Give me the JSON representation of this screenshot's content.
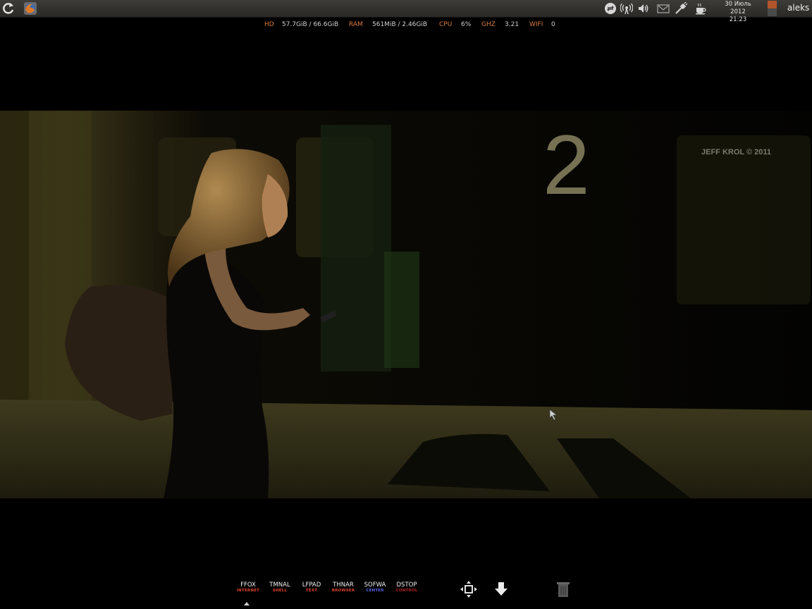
{
  "top_panel": {
    "clock": {
      "date": "30 Июль 2012",
      "time": "21:23"
    },
    "user": "aleks",
    "icons": [
      "refresh-icon",
      "firefox-icon",
      "sync-icon",
      "wifi-signal-icon",
      "volume-icon",
      "mail-icon",
      "network-cable-icon",
      "coffee-cup-icon"
    ]
  },
  "conky": {
    "hd_label": "HD",
    "hd_value": "57.7GiB / 66.6GiB",
    "ram_label": "RAM",
    "ram_value": "561MiB / 2.46GiB",
    "cpu_label": "CPU",
    "cpu_value": "6%",
    "ghz_label": "GHZ",
    "ghz_value": "3.21",
    "wifi_label": "WIFI",
    "wifi_value": "0"
  },
  "wallpaper": {
    "platform_number": "2",
    "watermark": "JEFF KROL © 2011"
  },
  "dock": {
    "items": [
      {
        "title": "FFOX",
        "subtitle": "INTERNET",
        "color": "#e0402a"
      },
      {
        "title": "TMNAL",
        "subtitle": "SHELL",
        "color": "#e0402a"
      },
      {
        "title": "LFPAD",
        "subtitle": "TEXT",
        "color": "#e0402a"
      },
      {
        "title": "THNAR",
        "subtitle": "BROWSER",
        "color": "#e0402a"
      },
      {
        "title": "SOFWA",
        "subtitle": "CENTER",
        "color": "#5a62e8"
      },
      {
        "title": "DSTOP",
        "subtitle": "CONTROL",
        "color": "#b02020"
      }
    ],
    "icons": [
      "move-window-icon",
      "download-arrow-icon",
      "trash-icon"
    ]
  }
}
